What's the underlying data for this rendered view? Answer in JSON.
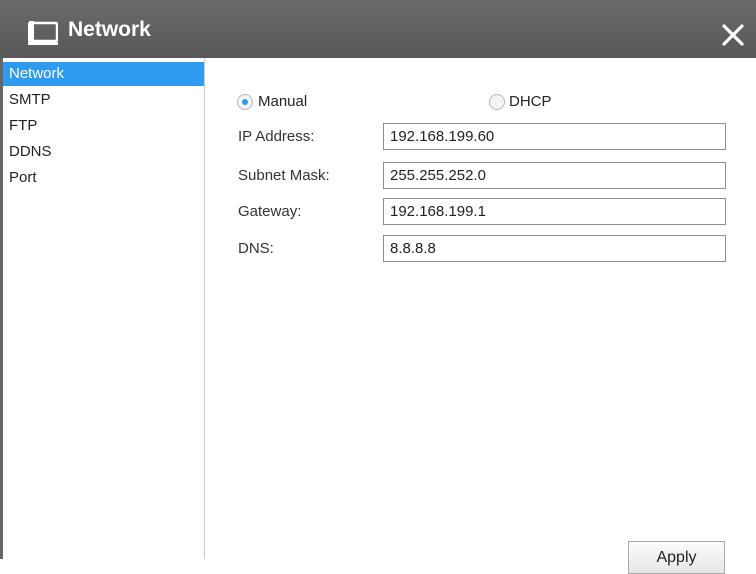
{
  "window": {
    "title": "Network",
    "icon": "network-monitor-icon",
    "close_icon": "close-icon"
  },
  "sidebar": {
    "items": [
      {
        "label": "Network",
        "selected": true
      },
      {
        "label": "SMTP",
        "selected": false
      },
      {
        "label": "FTP",
        "selected": false
      },
      {
        "label": "DDNS",
        "selected": false
      },
      {
        "label": "Port",
        "selected": false
      }
    ]
  },
  "mode": {
    "options": [
      {
        "label": "Manual",
        "checked": true
      },
      {
        "label": "DHCP",
        "checked": false
      }
    ]
  },
  "fields": {
    "ip_address": {
      "label": "IP Address:",
      "value": "192.168.199.60"
    },
    "subnet_mask": {
      "label": "Subnet Mask:",
      "value": "255.255.252.0"
    },
    "gateway": {
      "label": "Gateway:",
      "value": "192.168.199.1"
    },
    "dns": {
      "label": "DNS:",
      "value": "8.8.8.8"
    }
  },
  "actions": {
    "apply_label": "Apply"
  },
  "colors": {
    "titlebar": "#5f5f5f",
    "selection": "#2e9bf0",
    "radio_dot": "#2e9bf0"
  }
}
